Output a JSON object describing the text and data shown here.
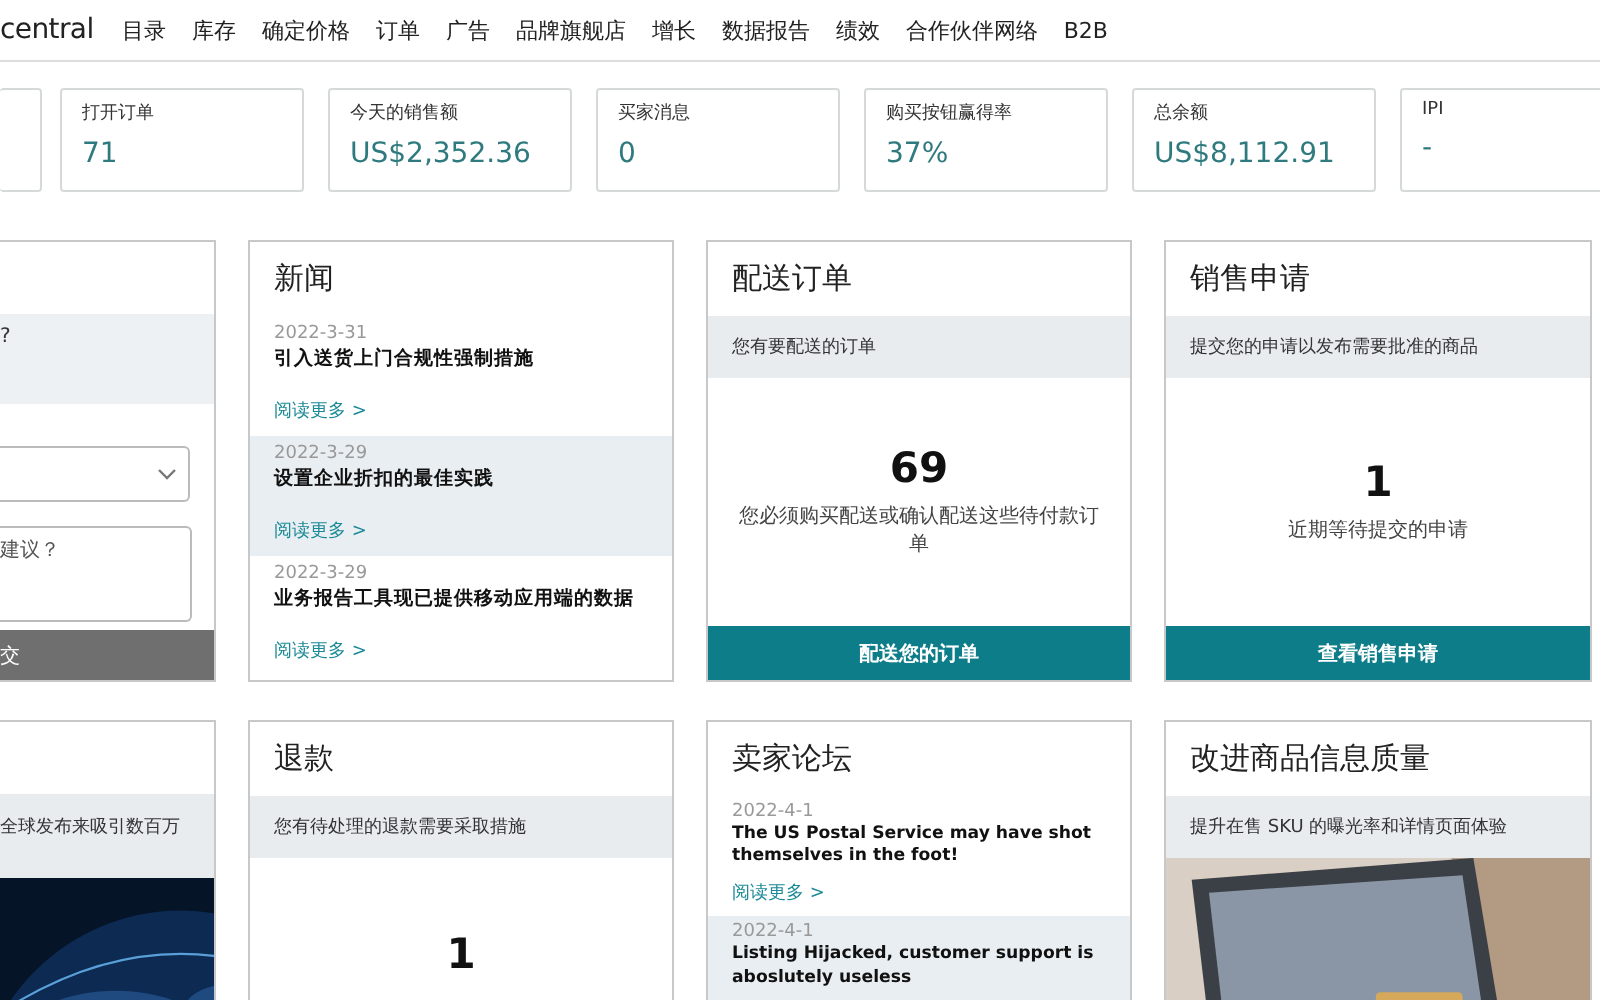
{
  "nav": {
    "logo": "central",
    "items": [
      "目录",
      "库存",
      "确定价格",
      "订单",
      "广告",
      "品牌旗舰店",
      "增长",
      "数据报告",
      "绩效",
      "合作伙伴网络",
      "B2B"
    ]
  },
  "metrics": [
    {
      "label": "打开订单",
      "value": "71"
    },
    {
      "label": "今天的销售额",
      "value": "US$2,352.36"
    },
    {
      "label": "买家消息",
      "value": "0"
    },
    {
      "label": "购买按钮赢得率",
      "value": "37%"
    },
    {
      "label": "总余额",
      "value": "US$8,112.91"
    },
    {
      "label": "IPI",
      "value": "-"
    }
  ],
  "rows": [
    [
      {
        "kind": "feedback",
        "question": "?",
        "placeholder": "建议？",
        "button": "交"
      },
      {
        "kind": "news",
        "title": "新闻",
        "items": [
          {
            "date": "2022-3-31",
            "headline": "引入送货上门合规性强制措施",
            "link": "阅读更多 >",
            "highlighted": false
          },
          {
            "date": "2022-3-29",
            "headline": "设置企业折扣的最佳实践",
            "link": "阅读更多 >",
            "highlighted": true
          },
          {
            "date": "2022-3-29",
            "headline": "业务报告工具现已提供移动应用端的数据",
            "link": "阅读更多 >",
            "highlighted": false
          }
        ]
      },
      {
        "kind": "action",
        "title": "配送订单",
        "band": "您有要配送的订单",
        "count": "69",
        "note": "您必须购买配送或确认配送这些待付款订单",
        "button": "配送您的订单"
      },
      {
        "kind": "action",
        "title": "销售申请",
        "band": "提交您的申请以发布需要批准的商品",
        "count": "1",
        "note": "近期等待提交的申请",
        "button": "查看销售申请"
      }
    ],
    [
      {
        "kind": "promo",
        "band": "全球发布来吸引数百万"
      },
      {
        "kind": "action",
        "title": "退款",
        "band": "您有待处理的退款需要采取措施",
        "count": "1"
      },
      {
        "kind": "forum",
        "title": "卖家论坛",
        "items": [
          {
            "date": "2022-4-1",
            "headline": "The US Postal Service may have shot themselves in the foot!",
            "link": "阅读更多 >",
            "highlighted": false
          },
          {
            "date": "2022-4-1",
            "headline": "Listing Hijacked, customer support is aboslutely useless",
            "highlighted": true
          }
        ]
      },
      {
        "kind": "promo",
        "title": "改进商品信息质量",
        "band": "提升在售 SKU 的曝光率和详情页面体验"
      }
    ]
  ]
}
